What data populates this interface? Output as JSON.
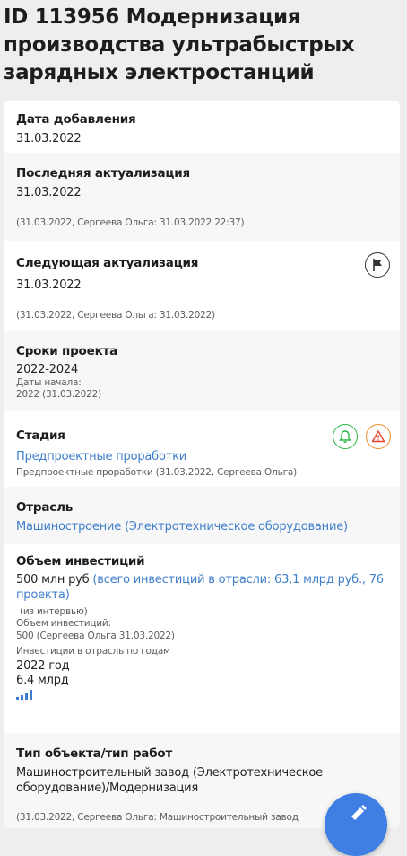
{
  "project": {
    "title": "ID 113956 Модернизация производства ультрабыстрых зарядных электростанций"
  },
  "date_added": {
    "label": "Дата добавления",
    "value": "31.03.2022"
  },
  "last_update": {
    "label": "Последняя актуализация",
    "value": "31.03.2022",
    "note_prefix": "(31.03.2022, Сергеева Ольга:",
    "note_suffix": " 31.03.2022 22:37)"
  },
  "next_update": {
    "label": "Следующая актуализация",
    "value": "31.03.2022",
    "note_prefix": "(31.03.2022, Сергеева Ольга:",
    "note_suffix": " 31.03.2022)",
    "icon": "flag-icon"
  },
  "timeline": {
    "label": "Сроки проекта",
    "value": "2022-2024",
    "start_label": "Даты начала:",
    "start_value": "2022 (31.03.2022)"
  },
  "stage": {
    "label": "Стадия",
    "value": "Предпроектные проработки",
    "note": "Предпроектные проработки (31.03.2022, Сергеева Ольга)",
    "icons": [
      "bell-icon",
      "warning-icon"
    ],
    "colors": {
      "bell": "#2db84a",
      "warning": "#f08a24"
    }
  },
  "industry": {
    "label": "Отрасль",
    "value": "Машиностроение (Электротехническое оборудование)"
  },
  "investment": {
    "label": "Объем инвестиций",
    "value": "500 млн руб",
    "total_link": "(всего инвестиций в отрасли: 63,1 млрд руб., 76 проекта)",
    "source": "(из интервью)",
    "history_label": "Объем инвестиций:",
    "history_value": "500 (Сергеева Ольга 31.03.2022)",
    "by_year_label": "Инвестиции в отрасль по годам",
    "year": "2022 год",
    "year_value": "6.4 млрд"
  },
  "object_type": {
    "label": "Тип объекта/тип работ",
    "value": "Машиностроительный завод (Электротехническое оборудование)/Модернизация",
    "note": "(31.03.2022, Сергеева Ольга: Машиностроительный завод"
  },
  "fab": {
    "icon": "edit-icon",
    "color": "#3f7ee3"
  }
}
